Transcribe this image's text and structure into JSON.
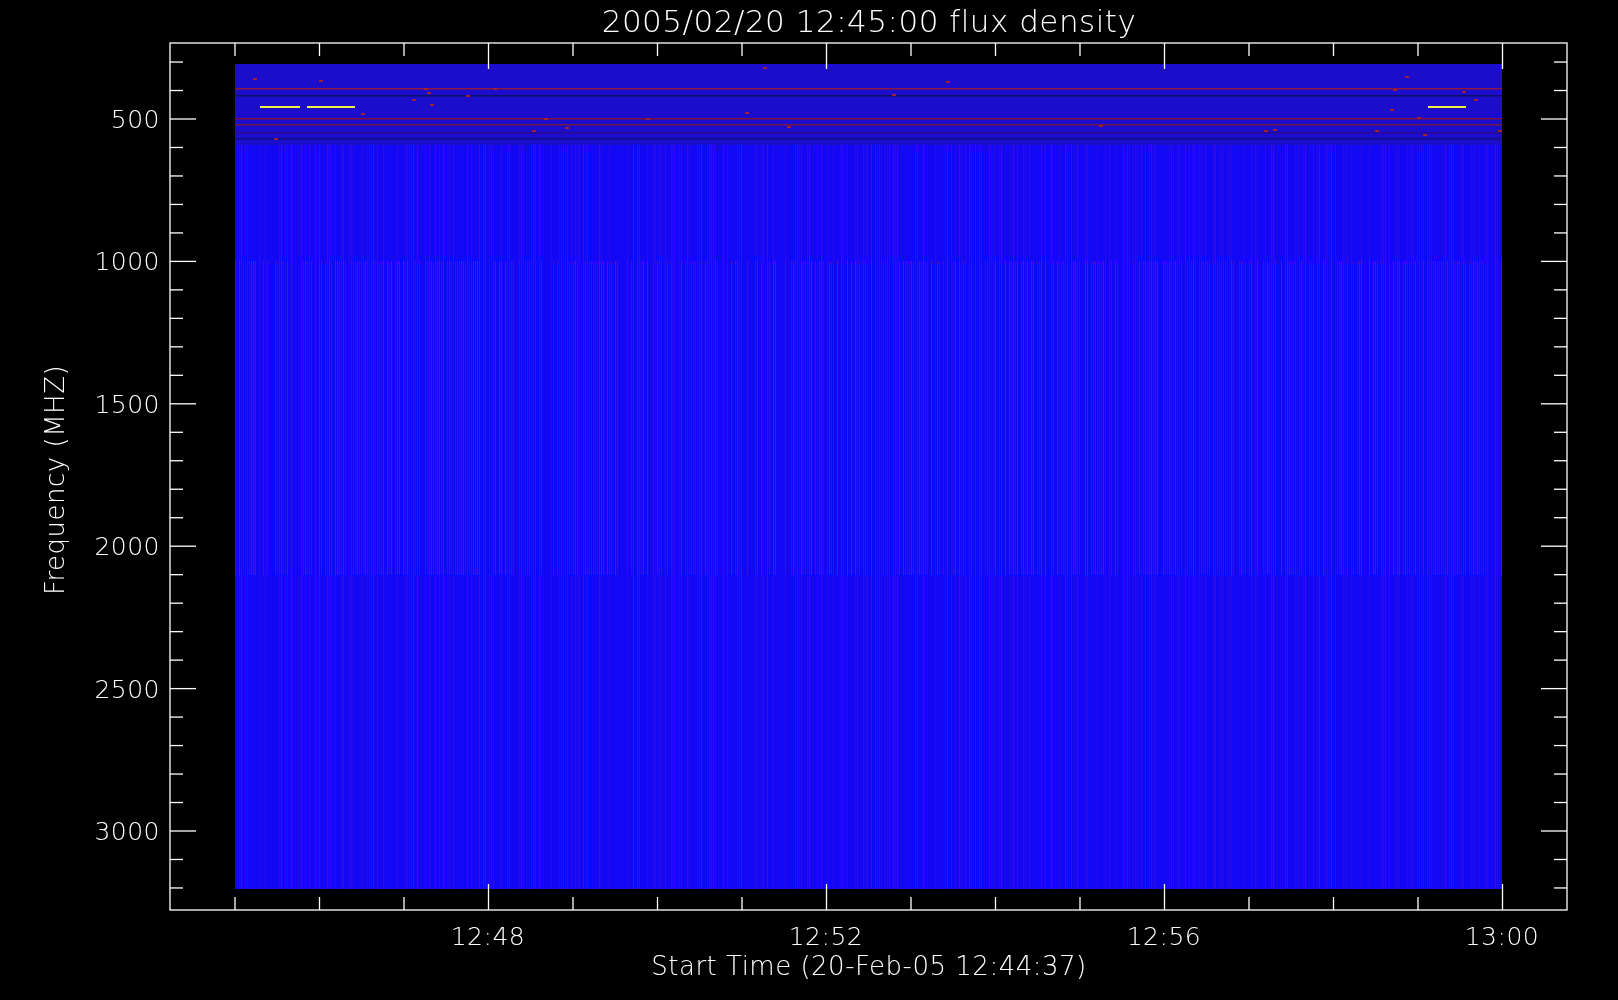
{
  "plot": {
    "title": "2005/02/20 12:45:00 flux density",
    "ylabel": "Frequency (MHZ)",
    "xlabel": "Start Time (20-Feb-05 12:44:37)",
    "yticks": [
      "500",
      "1000",
      "1500",
      "2000",
      "2500",
      "3000"
    ],
    "xticks": [
      "12:48",
      "12:52",
      "12:56",
      "13:00"
    ]
  }
}
